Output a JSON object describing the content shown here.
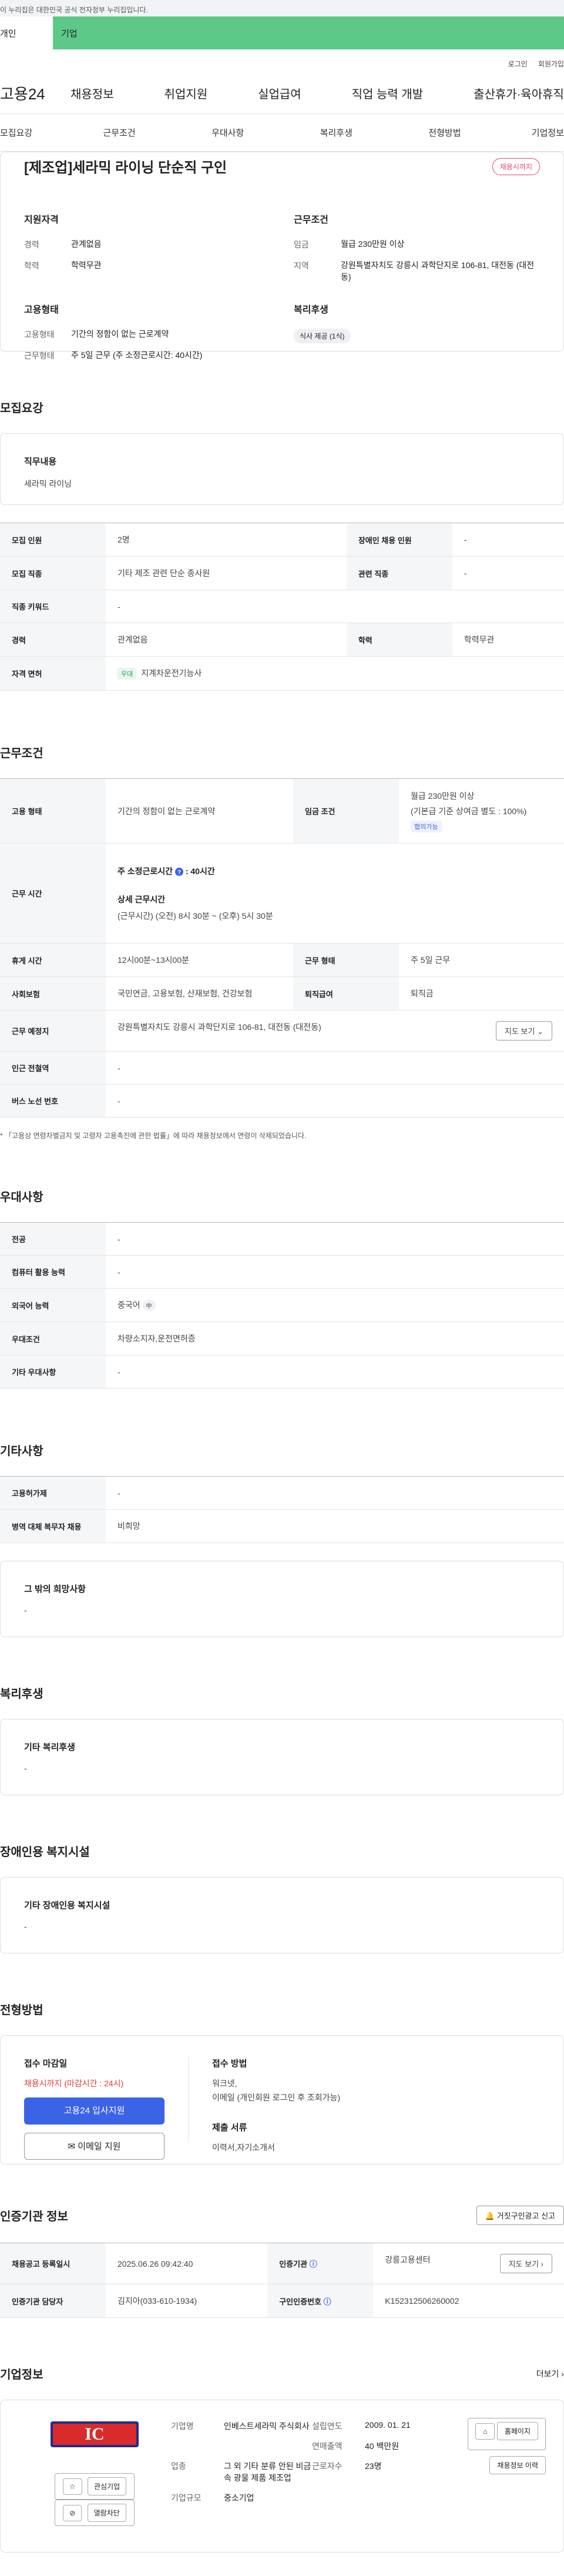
{
  "banner": {
    "text": "이 누리집은 대한민국 공식 전자정부 누리집입니다."
  },
  "tabs": {
    "person": "개인",
    "company": "기업"
  },
  "util": {
    "login": "로그인",
    "signup": "회원가입"
  },
  "gnb": {
    "logo": "고용24",
    "menu": [
      "채용정보",
      "취업지원",
      "실업급여",
      "직업 능력 개발",
      "출산휴가·육아휴직"
    ]
  },
  "anchors": [
    "모집요강",
    "근무조건",
    "우대사항",
    "복리후생",
    "전형방법",
    "기업정보"
  ],
  "summary": {
    "title": "[제조업]세라믹 라이닝 단순직 구인",
    "deadline_badge": "채용시까지",
    "qual_title": "지원자격",
    "career_k": "경력",
    "career_v": "관계없음",
    "edu_k": "학력",
    "edu_v": "학력무관",
    "cond_title": "근무조건",
    "wage_k": "임금",
    "wage_v": "월급 230만원 이상",
    "region_k": "지역",
    "region_v": "강원특별자치도 강릉시 과학단지로 106-81, 대전동 (대전동)",
    "emp_title": "고용형태",
    "emp_k": "고용형태",
    "emp_v": "기간의 정함이 없는 근로계약",
    "work_k": "근무형태",
    "work_v": "주 5일 근무 (주 소정근로시간: 40시간)",
    "welfare_title": "복리후생",
    "welfare_chip": "식사 제공 (1식)"
  },
  "recruit": {
    "title": "모집요강",
    "job_title": "직무내용",
    "job_text": "세라믹 라이닝",
    "rows": [
      [
        "모집 인원",
        "2명",
        "장애인 채용 인원",
        "-"
      ],
      [
        "모집 직종",
        "기타 제조 관련 단순 종사원",
        "관련 직종",
        "-"
      ],
      [
        "직종 키워드",
        "-"
      ],
      [
        "경력",
        "관계없음",
        "학력",
        "학력무관"
      ],
      [
        "자격 면허",
        "지계차운전기능사"
      ]
    ],
    "license_badge": "우대"
  },
  "conditions": {
    "title": "근무조건",
    "emp_k": "고용 형태",
    "emp_v": "기간의 정함이 없는 근로계약",
    "wage_k": "임금 조건",
    "wage_v1": "월급 230만원 이상",
    "wage_v2": "(기본급 기준 상여금 별도 : 100%)",
    "wage_badge": "협의가능",
    "hours_k": "근무 시간",
    "hours_v1": "주 소정근로시간",
    "hours_v1b": ": 40시간",
    "hours_v2": "상세 근무시간",
    "hours_v3": "(근무시간) (오전) 8시 30분 ~ (오후) 5시 30분",
    "break_k": "휴게 시간",
    "break_v": "12시00분~13시00분",
    "worktype_k": "근무 형태",
    "worktype_v": "주 5일 근무",
    "insure_k": "사회보험",
    "insure_v": "국민연금, 고용보험, 산재보험, 건강보험",
    "retire_k": "퇴직급여",
    "retire_v": "퇴직금",
    "place_k": "근무 예정지",
    "place_v": "강원특별자치도 강릉시 과학단지로 106-81, 대전동 (대전동)",
    "map_btn": "지도 보기",
    "subway_k": "인근 전철역",
    "subway_v": "-",
    "bus_k": "버스 노선 번호",
    "bus_v": "-",
    "note": "* 「고용상 연령차별금지 및 고령자 고용촉진에 관한 법률」에 따라 채용정보에서 연령이 삭제되었습니다."
  },
  "preference": {
    "title": "우대사항",
    "rows": [
      [
        "전공",
        "-"
      ],
      [
        "컴퓨터 활용 능력",
        "-"
      ],
      [
        "외국어 능력",
        "중국어"
      ],
      [
        "우대조건",
        "차량소지자,운전면허증"
      ],
      [
        "기타 우대사항",
        "-"
      ]
    ],
    "lang_badge": "中"
  },
  "etc": {
    "title": "기타사항",
    "rows": [
      [
        "고용허가제",
        "-"
      ],
      [
        "병역 대체 복무자 채용",
        "비희망"
      ]
    ],
    "wish_title": "그 밖의 희망사항",
    "wish_text": "-"
  },
  "welfare": {
    "title": "복리후생",
    "card_title": "기타 복리후생",
    "card_text": "-"
  },
  "disabled": {
    "title": "장애인용 복지시설",
    "card_title": "기타 장애인용 복지시설",
    "card_text": "-"
  },
  "apply": {
    "title": "전형방법",
    "deadline_title": "접수 마감일",
    "deadline_text": "채용시까지 (마감시간 : 24시)",
    "btn_apply": "고용24 입사지원",
    "btn_email": "이메일 지원",
    "method_title": "접수 방법",
    "method_text1": "워크넷,",
    "method_text2": "이메일 (개인회원 로그인 후 조회가능)",
    "docs_title": "제출 서류",
    "docs_text": "이력서,자기소개서"
  },
  "cert": {
    "title": "인증기관 정보",
    "report_btn": "거짓구인광고 신고",
    "reg_k": "채용공고 등록일시",
    "reg_v": "2025.06.26 09:42:40",
    "org_k": "인증기관",
    "org_v": "강릉고용센터",
    "map_btn": "지도 보기",
    "mgr_k": "인증기관 담당자",
    "mgr_v": "김지아(033-610-1934)",
    "no_k": "구인인증번호",
    "no_v": "K152312506260002"
  },
  "company": {
    "title": "기업정보",
    "more": "더보기",
    "logo": "IC",
    "btn_fav": "관심기업",
    "btn_block": "열람차단",
    "name_k": "기업명",
    "name_v": "인베스트세라믹 주식회사",
    "year_k": "설립연도",
    "year_v": "2009. 01. 21",
    "sales_k": "연매출액",
    "sales_v": "40 백만원",
    "ind_k": "업종",
    "ind_v": "그 외 기타 분류 안된 비금속 광물 제품 제조업",
    "emp_k": "근로자수",
    "emp_v": "23명",
    "size_k": "기업규모",
    "size_v": "중소기업",
    "btn_home": "홈페이지",
    "btn_history": "채용정보 이력"
  }
}
